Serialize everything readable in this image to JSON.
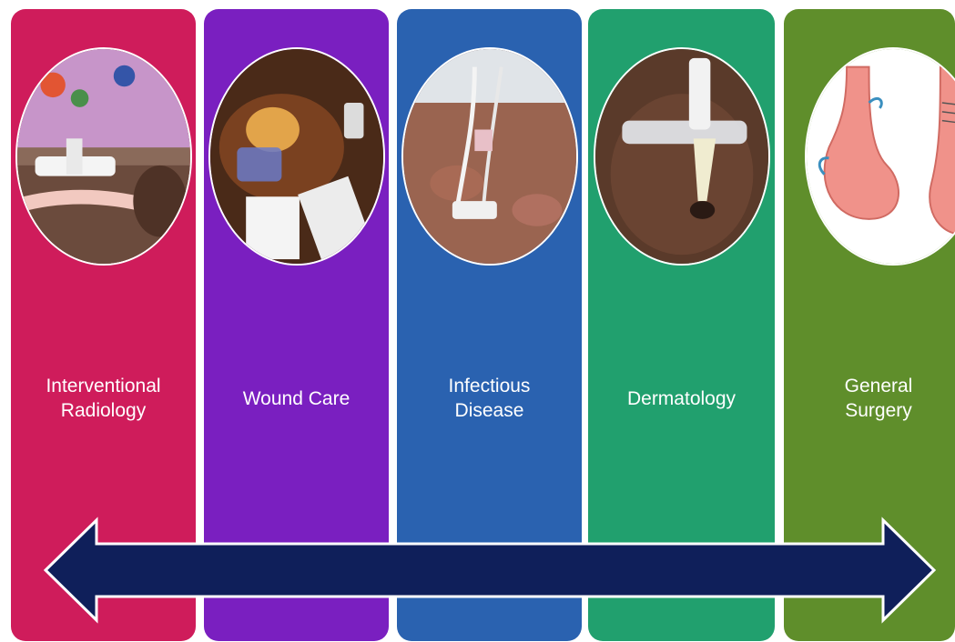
{
  "panels": [
    {
      "label": "Interventional\nRadiology",
      "color": "#cf1c5b",
      "icon": "drainage-catheter-photo"
    },
    {
      "label": "Wound Care",
      "color": "#7a1fc0",
      "icon": "wound-drain-photo"
    },
    {
      "label": "Infectious\nDisease",
      "color": "#2a62b0",
      "icon": "iv-line-photo"
    },
    {
      "label": "Dermatology",
      "color": "#21a06e",
      "icon": "skin-tube-photo"
    },
    {
      "label": "General\nSurgery",
      "color": "#5f8e2b",
      "icon": "stomach-illustration"
    }
  ],
  "arrow": {
    "color": "#0f1f5a",
    "outline": "#ffffff",
    "direction": "bidirectional"
  }
}
